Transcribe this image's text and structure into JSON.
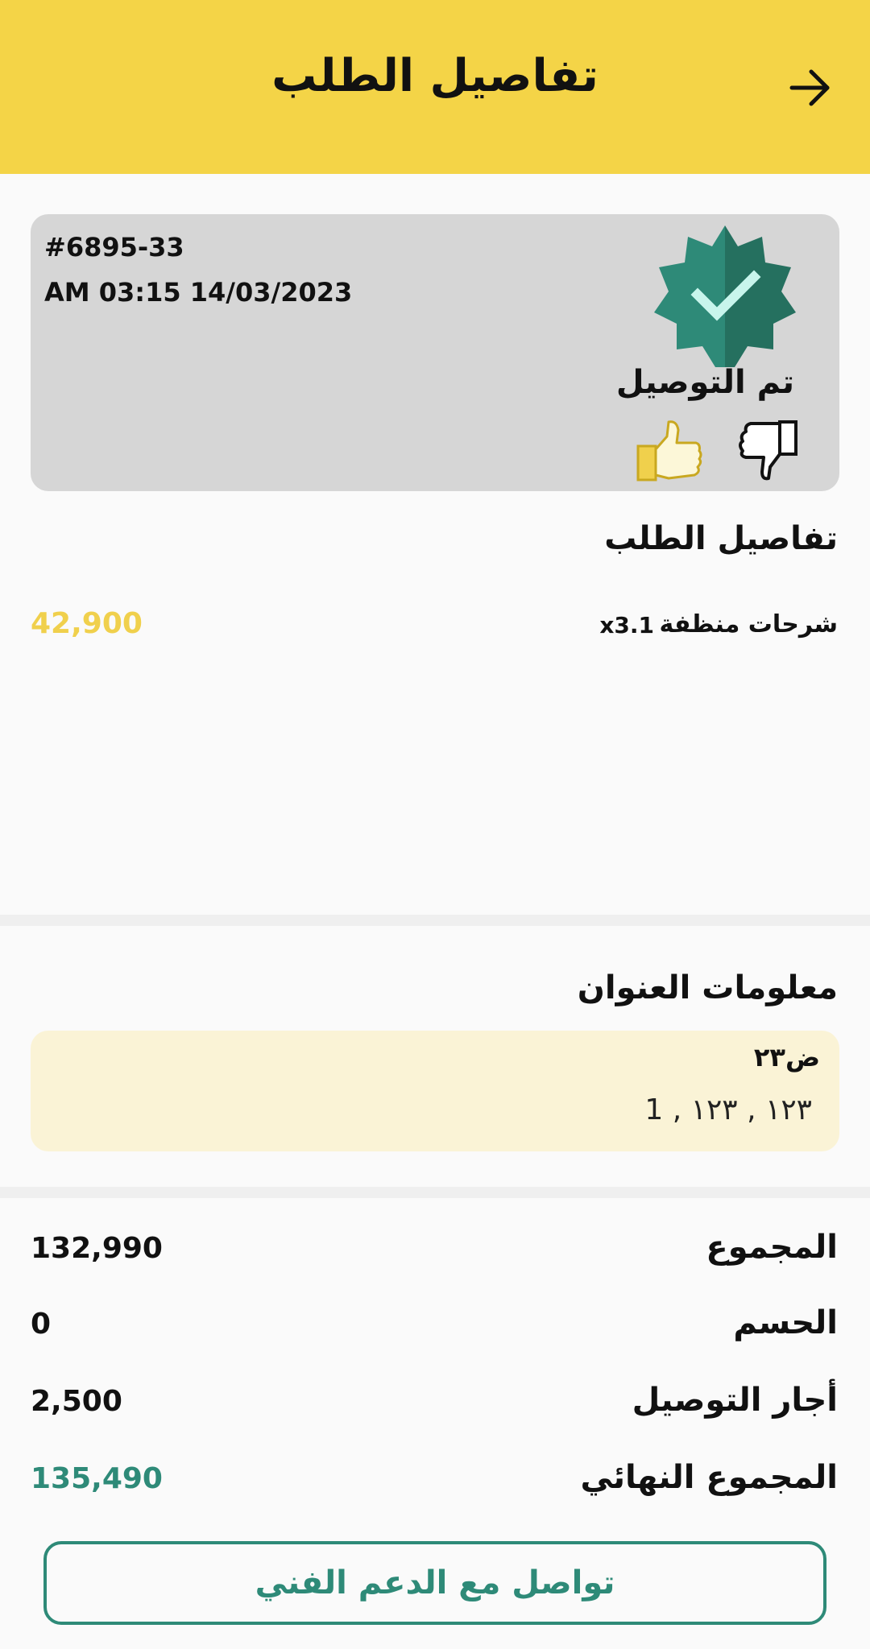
{
  "header": {
    "title": "تفاصيل الطلب",
    "back_icon": "arrow-right-icon",
    "bg_color": "#f4d447"
  },
  "status_card": {
    "order_id": "#6895-33",
    "datetime": "AM 03:15 14/03/2023",
    "status_label": "تم التوصيل",
    "badge_icon": "verified-check-badge-icon",
    "badge_color": "#2e8a78",
    "thumb_up_icon": "thumbs-up-icon",
    "thumb_down_icon": "thumbs-down-icon"
  },
  "order_details": {
    "title": "تفاصيل الطلب",
    "items": [
      {
        "name": "شرحات منظفة",
        "qty": "x3.1",
        "price": "42,900"
      }
    ]
  },
  "address": {
    "title": "معلومات العنوان",
    "name": "ض٢٣",
    "line": "١٢٣ , ١٢٣ , 1"
  },
  "totals": {
    "subtotal": {
      "label": "المجموع",
      "value": "132,990"
    },
    "discount": {
      "label": "الحسم",
      "value": "0"
    },
    "delivery": {
      "label": "أجار التوصيل",
      "value": "2,500"
    },
    "final": {
      "label": "المجموع النهائي",
      "value": "135,490"
    }
  },
  "support_button": {
    "label": "تواصل مع الدعم الفني"
  },
  "colors": {
    "accent_yellow": "#f4d447",
    "accent_green": "#2e8a78",
    "price_yellow": "#f0d04c"
  }
}
